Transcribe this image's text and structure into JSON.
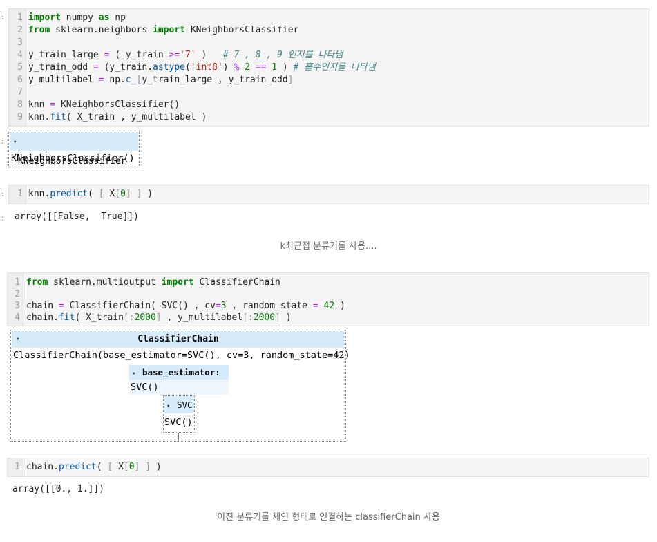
{
  "cells": {
    "c1": {
      "lines": [
        {
          "n": "1"
        },
        {
          "n": "2"
        },
        {
          "n": "3"
        },
        {
          "n": "4"
        },
        {
          "n": "5"
        },
        {
          "n": "6"
        },
        {
          "n": "7"
        },
        {
          "n": "8"
        },
        {
          "n": "9"
        }
      ],
      "t": {
        "l1_a": "import",
        "l1_b": " numpy ",
        "l1_c": "as",
        "l1_d": " np",
        "l2_a": "from",
        "l2_b": " sklearn.neighbors ",
        "l2_c": "import",
        "l2_d": " KNeighborsClassifier",
        "l4_a": "y_train_large ",
        "l4_b": "=",
        "l4_c": " ( y_train ",
        "l4_d": ">=",
        "l4_e": "'7'",
        "l4_f": " )   ",
        "l4_g": "# 7 , 8 , 9 인지를 나타냄",
        "l5_a": "y_train_odd ",
        "l5_b": "=",
        "l5_c": " (y_train.",
        "l5_d": "astype",
        "l5_e": "(",
        "l5_f": "'int8'",
        "l5_g": ") ",
        "l5_h": "%",
        "l5_i": " ",
        "l5_j": "2",
        "l5_k": " ",
        "l5_l": "==",
        "l5_m": " ",
        "l5_n": "1",
        "l5_o": " ) ",
        "l5_p": "# 홀수인지를 나타냄",
        "l6_a": "y_multilabel ",
        "l6_b": "=",
        "l6_c": " np.",
        "l6_d": "c_",
        "l6_e": "[",
        "l6_f": "y_train_large , y_train_odd",
        "l6_g": "]",
        "l8_a": "knn ",
        "l8_b": "=",
        "l8_c": " KNeighborsClassifier()",
        "l9_a": "knn.",
        "l9_b": "fit",
        "l9_c": "( X_train , y_multilabel )"
      }
    },
    "c2": {
      "n": "1",
      "t": {
        "a": "knn.",
        "b": "predict",
        "c": "( ",
        "d": "[",
        "e": " X",
        "f": "[",
        "g": "0",
        "h": "]",
        "i": " ",
        "j": "]",
        "k": " )"
      }
    },
    "c3": {
      "n": [
        "1",
        "2",
        "3",
        "4"
      ],
      "t": {
        "l1_a": "from",
        "l1_b": " sklearn.multioutput ",
        "l1_c": "import",
        "l1_d": " ClassifierChain",
        "l3_a": "chain ",
        "l3_b": "=",
        "l3_c": " ClassifierChain( SVC() , cv",
        "l3_d": "=",
        "l3_e": "3",
        "l3_f": " , random_state ",
        "l3_g": "=",
        "l3_h": " ",
        "l3_i": "42",
        "l3_j": " )",
        "l4_a": "chain.",
        "l4_b": "fit",
        "l4_c": "( X_train",
        "l4_d": "[:",
        "l4_e": "2000",
        "l4_f": "]",
        "l4_g": " , y_multilabel",
        "l4_h": "[:",
        "l4_i": "2000",
        "l4_j": "]",
        "l4_k": " )"
      }
    },
    "c4": {
      "n": "1",
      "t": {
        "a": "chain.",
        "b": "predict",
        "c": "( ",
        "d": "[",
        "e": " X",
        "f": "[",
        "g": "0",
        "h": "]",
        "i": " ",
        "j": "]",
        "k": " )"
      }
    }
  },
  "prompt_colon": ":",
  "out_knn": {
    "toggle": "▾",
    "head": "KNeighborsClassifier",
    "body": "KNeighborsClassifier()"
  },
  "out_predict1": "array([[False,  True]])",
  "caption1": "k최근접 분류기를 사용....",
  "out_chain": {
    "toggle": "▾",
    "head": "ClassifierChain",
    "body": "ClassifierChain(base_estimator=SVC(), cv=3, random_state=42)",
    "base_toggle": "▾",
    "base_head": "base_estimator: SVC",
    "base_body": "SVC()",
    "svc_toggle": "▾",
    "svc_head": "SVC",
    "svc_body": "SVC()"
  },
  "out_predict2": "array([[0., 1.]])",
  "caption2": "이진 분류기를 체인 형태로 연결하는 classifierChain 사용"
}
